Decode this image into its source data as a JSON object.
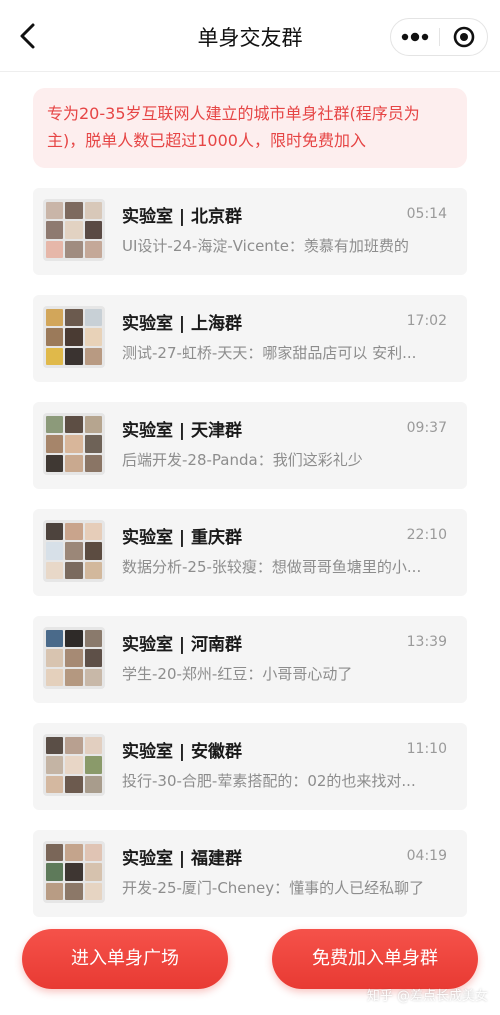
{
  "navbar": {
    "title": "单身交友群",
    "back_icon": "chevron-left-icon",
    "menu_icon": "more-dots-icon",
    "close_icon": "target-circle-icon"
  },
  "notice": {
    "text": "专为20-35岁互联网人建立的城市单身社群(程序员为主)，脱单人数已超过1000人，限时免费加入"
  },
  "groups": [
    {
      "name": "实验室 | 北京群",
      "time": "05:14",
      "message": "UI设计-24-海淀-Vicente：羡慕有加班费的"
    },
    {
      "name": "实验室 | 上海群",
      "time": "17:02",
      "message": "测试-27-虹桥-天天：哪家甜品店可以 安利..."
    },
    {
      "name": "实验室 | 天津群",
      "time": "09:37",
      "message": "后端开发-28-Panda：我们这彩礼少"
    },
    {
      "name": "实验室 | 重庆群",
      "time": "22:10",
      "message": "数据分析-25-张较瘦：想做哥哥鱼塘里的小..."
    },
    {
      "name": "实验室 | 河南群",
      "time": "13:39",
      "message": "学生-20-郑州-红豆：小哥哥心动了"
    },
    {
      "name": "实验室 | 安徽群",
      "time": "11:10",
      "message": "投行-30-合肥-荤素搭配的：02的也来找对..."
    },
    {
      "name": "实验室 | 福建群",
      "time": "04:19",
      "message": "开发-25-厦门-Cheney：懂事的人已经私聊了"
    }
  ],
  "buttons": {
    "square": "进入单身广场",
    "join": "免费加入单身群"
  },
  "watermark": "知乎 @差点长成美女",
  "colors": {
    "accent": "#e83a33",
    "notice_bg": "#fdeeee",
    "notice_text": "#e64545",
    "card_bg": "#f5f5f5"
  }
}
